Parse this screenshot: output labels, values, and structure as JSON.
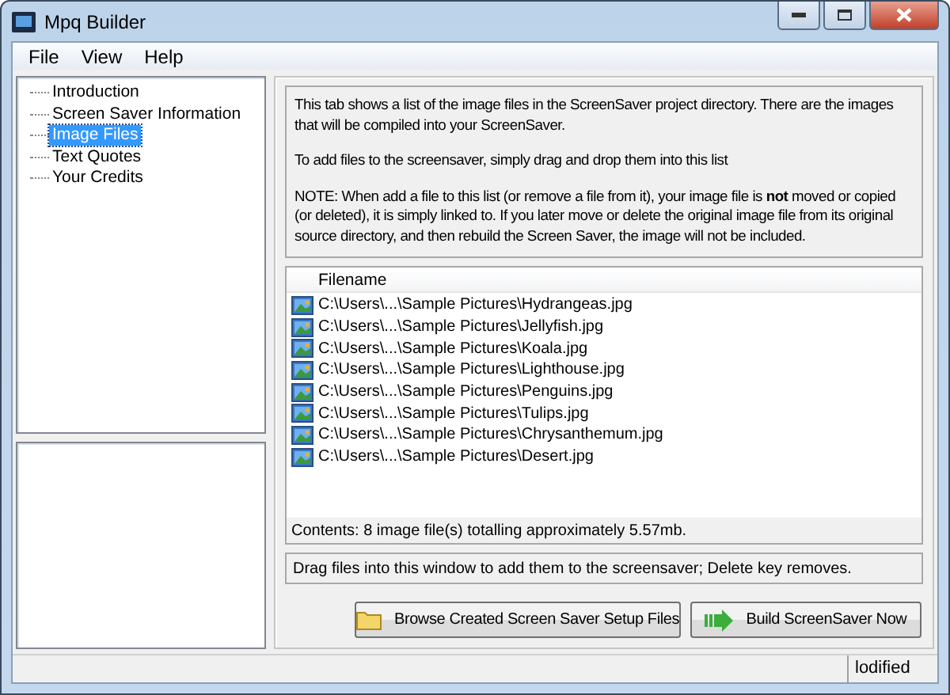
{
  "window": {
    "title": "Mpq Builder"
  },
  "menu": [
    "File",
    "View",
    "Help"
  ],
  "tree": [
    {
      "label": "Introduction",
      "selected": false
    },
    {
      "label": "Screen Saver Information",
      "selected": false
    },
    {
      "label": "Image Files",
      "selected": true
    },
    {
      "label": "Text Quotes",
      "selected": false
    },
    {
      "label": "Your Credits",
      "selected": false
    }
  ],
  "description": [
    "This tab shows a list of the image files in the ScreenSaver project directory. There are the images that will be compiled into your ScreenSaver.",
    "To add files to the screensaver, simply drag and drop them into this list",
    "NOTE: When add a file to this list (or remove a file from it), your image file is **not** moved or copied (or deleted), it is simply linked to. If you later move or delete the original image file from its original source directory, and then rebuild the Screen Saver, the image will not be included."
  ],
  "file_list": {
    "columns": [
      "Filename"
    ],
    "rows": [
      "C:\\Users\\...\\Sample Pictures\\Hydrangeas.jpg",
      "C:\\Users\\...\\Sample Pictures\\Jellyfish.jpg",
      "C:\\Users\\...\\Sample Pictures\\Koala.jpg",
      "C:\\Users\\...\\Sample Pictures\\Lighthouse.jpg",
      "C:\\Users\\...\\Sample Pictures\\Penguins.jpg",
      "C:\\Users\\...\\Sample Pictures\\Tulips.jpg",
      "C:\\Users\\...\\Sample Pictures\\Chrysanthemum.jpg",
      "C:\\Users\\...\\Sample Pictures\\Desert.jpg"
    ],
    "summary": "Contents: 8 image file(s) totalling approximately 5.57mb."
  },
  "hint": "Drag files into this window to add them to the screensaver; Delete key removes.",
  "buttons": [
    {
      "kind": "browse",
      "label": "Browse Created Screen Saver Setup Files"
    },
    {
      "kind": "build",
      "label": "Build ScreenSaver Now"
    }
  ],
  "status_bar": "lodified"
}
